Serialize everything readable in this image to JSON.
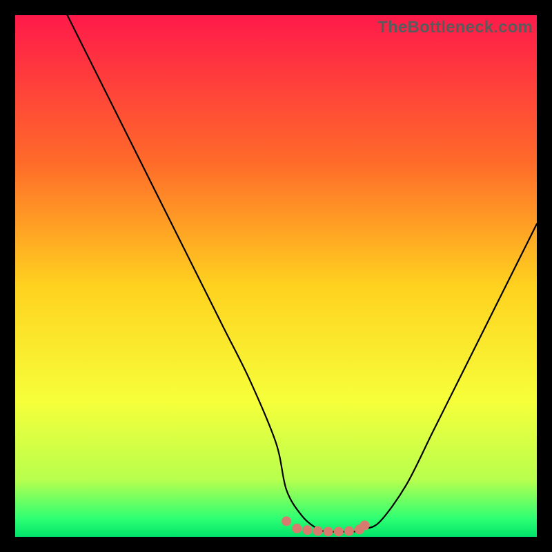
{
  "watermark": "TheBottleneck.com",
  "chart_data": {
    "type": "line",
    "title": "",
    "xlabel": "",
    "ylabel": "",
    "x_range": [
      0,
      100
    ],
    "y_range": [
      0,
      100
    ],
    "legend": false,
    "grid": false,
    "background_gradient": {
      "stops": [
        {
          "pos": 0.0,
          "color": "#ff1a4a"
        },
        {
          "pos": 0.28,
          "color": "#ff6a2a"
        },
        {
          "pos": 0.52,
          "color": "#ffd21f"
        },
        {
          "pos": 0.74,
          "color": "#f6ff3a"
        },
        {
          "pos": 0.89,
          "color": "#b8ff4e"
        },
        {
          "pos": 0.965,
          "color": "#2eff73"
        },
        {
          "pos": 1.0,
          "color": "#00e46a"
        }
      ]
    },
    "series": [
      {
        "name": "bottleneck-curve",
        "color": "#000000",
        "width": 2.2,
        "x": [
          10,
          15,
          20,
          25,
          30,
          35,
          40,
          45,
          50,
          52,
          55,
          58,
          60,
          62,
          65,
          67,
          70,
          75,
          80,
          85,
          90,
          95,
          100
        ],
        "values": [
          100,
          90,
          80,
          70,
          60,
          50,
          40,
          30,
          18,
          9,
          4,
          1.5,
          1,
          1,
          1,
          1.5,
          3,
          10,
          20,
          30,
          40,
          50,
          60
        ]
      },
      {
        "name": "trough-markers",
        "type": "scatter",
        "color": "#d97a6e",
        "size": 14,
        "x": [
          52,
          54,
          56,
          58,
          60,
          62,
          64,
          66,
          67
        ],
        "values": [
          3,
          1.6,
          1.3,
          1.1,
          1,
          1,
          1.1,
          1.4,
          2.2
        ]
      }
    ]
  }
}
